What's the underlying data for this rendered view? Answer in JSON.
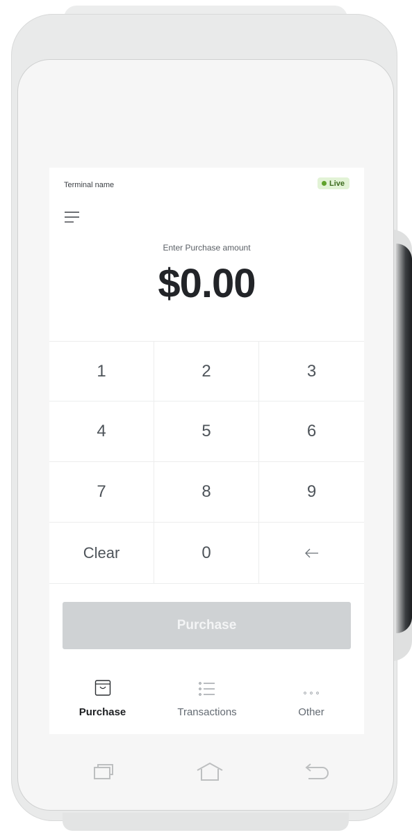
{
  "header": {
    "terminal_name": "Terminal name",
    "status_label": "Live",
    "status_color": "#5fa32b"
  },
  "menu": {
    "icon": "hamburger-menu-icon"
  },
  "amount": {
    "label": "Enter Purchase amount",
    "value": "$0.00"
  },
  "keypad": {
    "keys": [
      "1",
      "2",
      "3",
      "4",
      "5",
      "6",
      "7",
      "8",
      "9",
      "Clear",
      "0",
      "←"
    ],
    "backspace_icon": "back-arrow-icon"
  },
  "action": {
    "purchase_label": "Purchase",
    "state": "disabled"
  },
  "tabs": [
    {
      "label": "Purchase",
      "icon": "shopping-bag-icon",
      "active": true
    },
    {
      "label": "Transactions",
      "icon": "list-icon",
      "active": false
    },
    {
      "label": "Other",
      "icon": "more-dots-icon",
      "active": false
    }
  ],
  "device_nav": {
    "recent_icon": "recent-apps-icon",
    "home_icon": "home-icon",
    "back_icon": "back-icon"
  },
  "colors": {
    "accent": "#5fa32b",
    "button_disabled": "#cfd2d4",
    "text_dark": "#222428"
  }
}
